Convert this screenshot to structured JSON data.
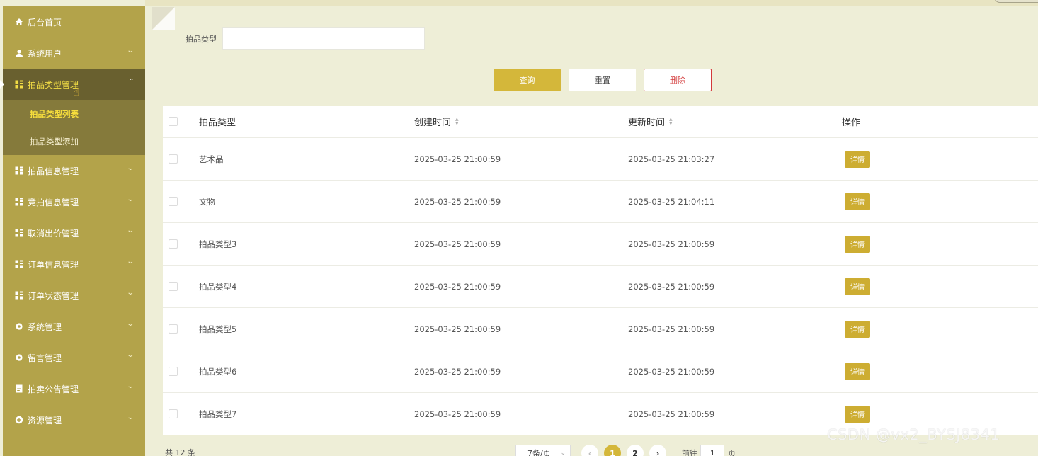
{
  "sidebar": {
    "items": [
      {
        "label": "后台首页",
        "icon": "home-icon"
      },
      {
        "label": "系统用户",
        "icon": "user-icon"
      },
      {
        "label": "拍品类型管理",
        "icon": "grid-icon"
      },
      {
        "label": "拍品信息管理",
        "icon": "grid-icon"
      },
      {
        "label": "竞拍信息管理",
        "icon": "grid-icon"
      },
      {
        "label": "取消出价管理",
        "icon": "grid-icon"
      },
      {
        "label": "订单信息管理",
        "icon": "grid-icon"
      },
      {
        "label": "订单状态管理",
        "icon": "grid-icon"
      },
      {
        "label": "系统管理",
        "icon": "gear-icon"
      },
      {
        "label": "留言管理",
        "icon": "gear-icon"
      },
      {
        "label": "拍卖公告管理",
        "icon": "document-icon"
      },
      {
        "label": "资源管理",
        "icon": "plus-circle-icon"
      }
    ],
    "submenu": [
      {
        "label": "拍品类型列表"
      },
      {
        "label": "拍品类型添加"
      }
    ]
  },
  "search": {
    "label": "拍品类型",
    "value": "",
    "placeholder": ""
  },
  "buttons": {
    "query": "查询",
    "reset": "重置",
    "delete": "删除"
  },
  "table": {
    "headers": [
      "拍品类型",
      "创建时间",
      "更新时间",
      "操作"
    ],
    "rows": [
      {
        "type": "艺术品",
        "created": "2025-03-25 21:00:59",
        "updated": "2025-03-25 21:03:27",
        "action": "详情"
      },
      {
        "type": "文物",
        "created": "2025-03-25 21:00:59",
        "updated": "2025-03-25 21:04:11",
        "action": "详情"
      },
      {
        "type": "拍品类型3",
        "created": "2025-03-25 21:00:59",
        "updated": "2025-03-25 21:00:59",
        "action": "详情"
      },
      {
        "type": "拍品类型4",
        "created": "2025-03-25 21:00:59",
        "updated": "2025-03-25 21:00:59",
        "action": "详情"
      },
      {
        "type": "拍品类型5",
        "created": "2025-03-25 21:00:59",
        "updated": "2025-03-25 21:00:59",
        "action": "详情"
      },
      {
        "type": "拍品类型6",
        "created": "2025-03-25 21:00:59",
        "updated": "2025-03-25 21:00:59",
        "action": "详情"
      },
      {
        "type": "拍品类型7",
        "created": "2025-03-25 21:00:59",
        "updated": "2025-03-25 21:00:59",
        "action": "详情"
      }
    ]
  },
  "pagination": {
    "total": "共 12 条",
    "page_size": "7条/页",
    "pages": [
      "1",
      "2"
    ],
    "current": "1",
    "goto_label": "前往",
    "goto_value": "1",
    "goto_unit": "页"
  },
  "watermark": "CSDN @vx2_BYSJ8341",
  "colors": {
    "sidebar": "#b3a34a",
    "sidebar_active": "#69602f",
    "accent": "#d4b73a",
    "danger": "#d33a3a",
    "background": "#eeeed7"
  }
}
